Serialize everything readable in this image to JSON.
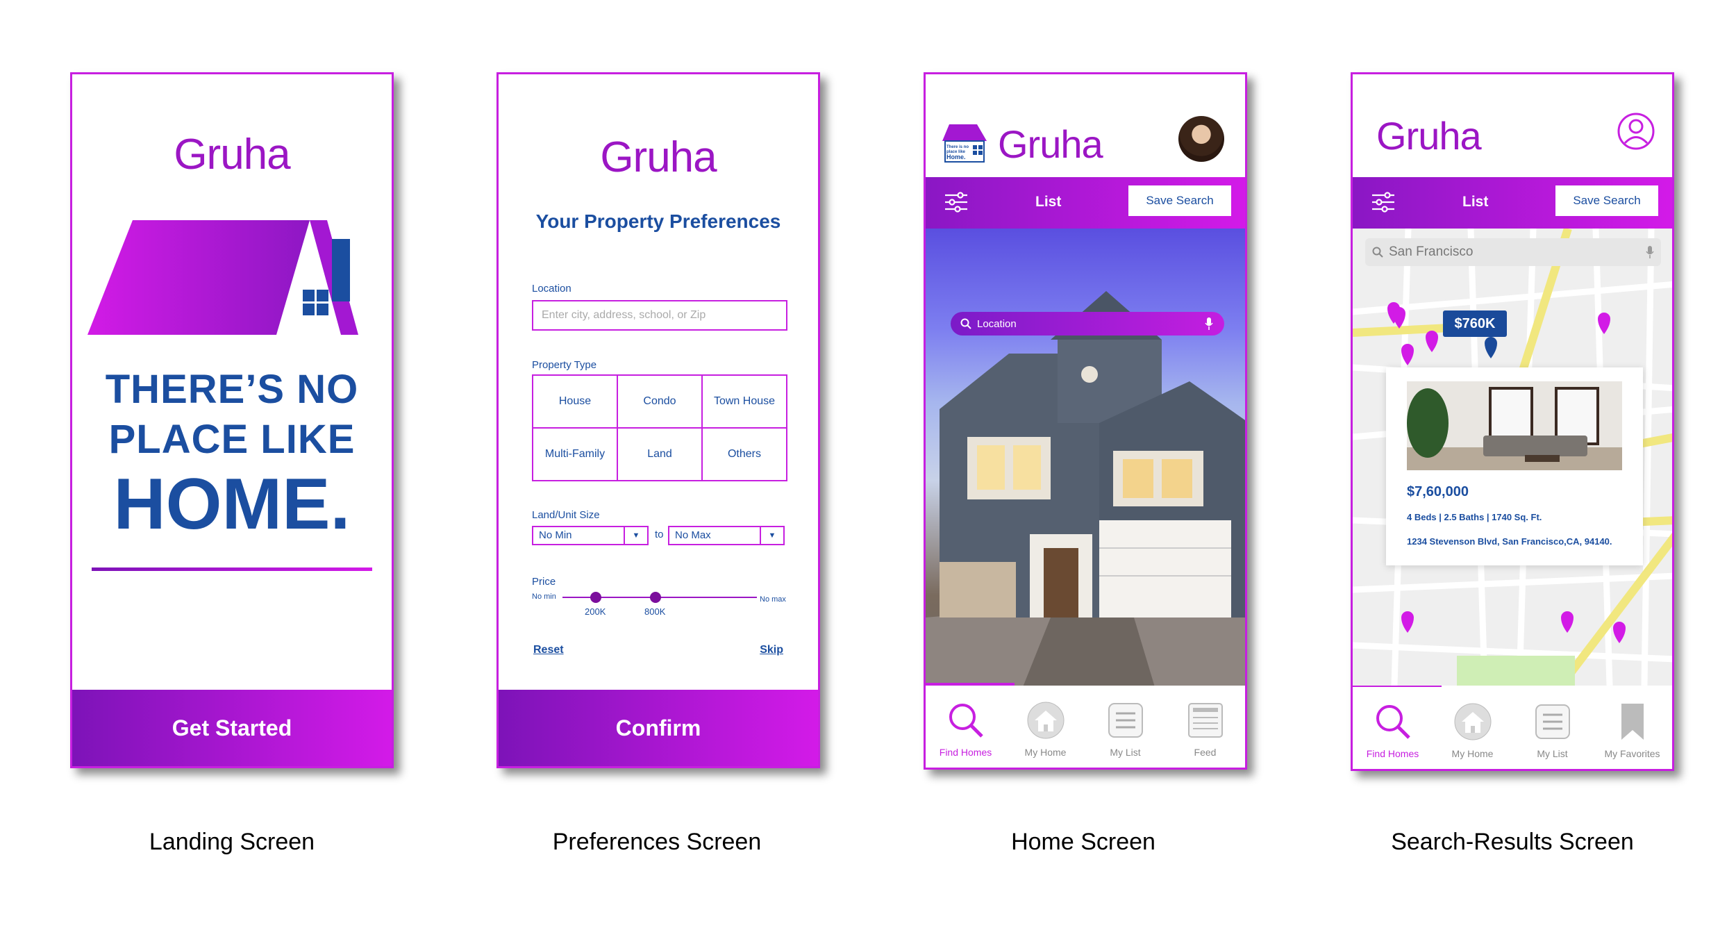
{
  "landing": {
    "brand": "Gruha",
    "slogan_line1": "THERE’S NO",
    "slogan_line2": "PLACE LIKE",
    "slogan_line3": "HOME.",
    "cta": "Get Started",
    "caption": "Landing Screen"
  },
  "preferences": {
    "brand": "Gruha",
    "title": "Your Property Preferences",
    "location_label": "Location",
    "location_placeholder": "Enter city, address, school, or Zip",
    "property_type_label": "Property Type",
    "property_types": [
      "House",
      "Condo",
      "Town House",
      "Multi-Family",
      "Land",
      "Others"
    ],
    "size_label": "Land/Unit Size",
    "size_min": "No Min",
    "size_to": "to",
    "size_max": "No Max",
    "price_label": "Price",
    "price_no_min": "No min",
    "price_no_max": "No max",
    "price_low": "200K",
    "price_high": "800K",
    "reset": "Reset",
    "skip": "Skip",
    "cta": "Confirm",
    "caption": "Preferences Screen"
  },
  "home": {
    "brand": "Gruha",
    "logo_text": "There is no place like Home.",
    "list_label": "List",
    "save_search": "Save Search",
    "search_placeholder": "Location",
    "tabs": [
      "Find Homes",
      "My Home",
      "My List",
      "Feed"
    ],
    "caption": "Home Screen"
  },
  "results": {
    "brand": "Gruha",
    "list_label": "List",
    "save_search": "Save Search",
    "map_search": "San Francisco",
    "price_tag": "$760K",
    "listing_price": "$7,60,000",
    "listing_details": "4 Beds | 2.5 Baths | 1740 Sq. Ft.",
    "listing_address": "1234 Stevenson Blvd, San Francisco,CA, 94140.",
    "tabs": [
      "Find Homes",
      "My Home",
      "My List",
      "My Favorites"
    ],
    "caption": "Search-Results Screen"
  },
  "colors": {
    "accent": "#c71fe0",
    "brand_purple": "#9b16c4",
    "navy": "#1b4ea0",
    "map_road": "#f1e77f",
    "map_park": "#cfeeb5"
  },
  "icons": [
    "search-icon",
    "microphone-icon",
    "filter-icon",
    "home-icon",
    "list-icon",
    "feed-icon",
    "bookmark-icon",
    "user-icon",
    "map-pin-icon"
  ]
}
